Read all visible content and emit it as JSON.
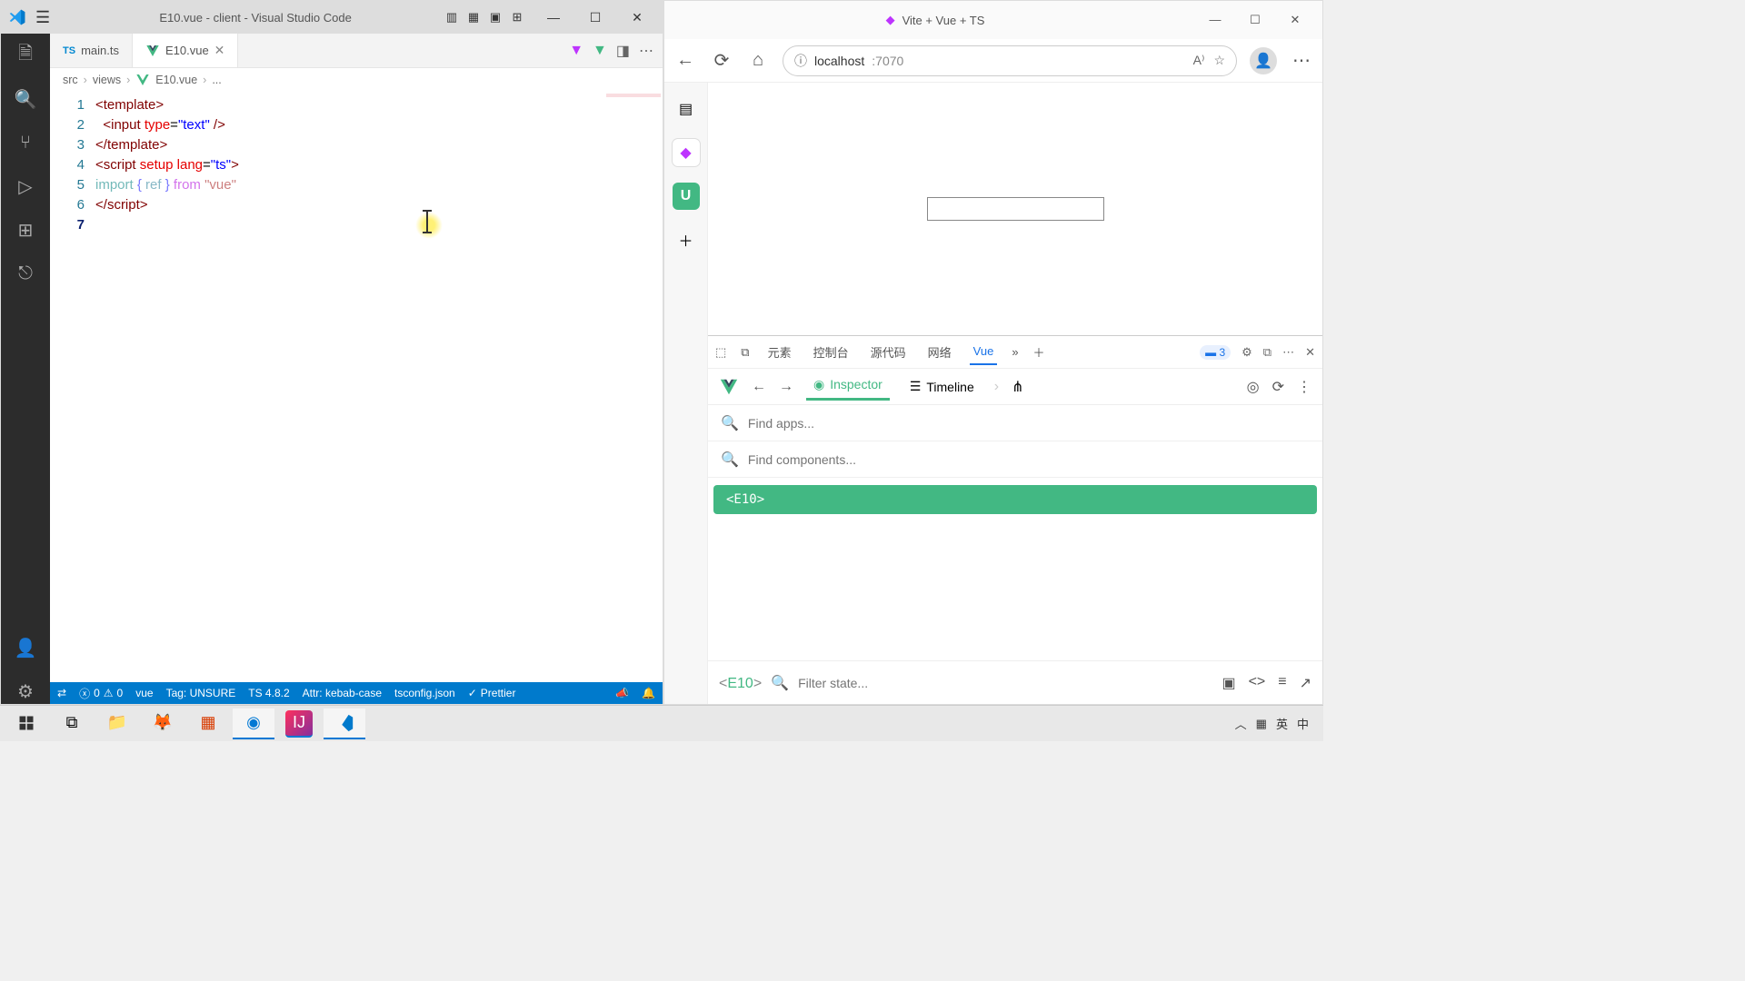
{
  "vscode": {
    "title": "E10.vue - client - Visual Studio Code",
    "tabs": [
      {
        "icon": "TS",
        "label": "main.ts",
        "active": false
      },
      {
        "icon": "V",
        "label": "E10.vue",
        "active": true
      }
    ],
    "breadcrumbs": {
      "a": "src",
      "b": "views",
      "c": "E10.vue",
      "d": "..."
    },
    "lines": [
      "1",
      "2",
      "3",
      "4",
      "5",
      "6",
      "7"
    ],
    "status": {
      "remote": "⇄",
      "errors": "0",
      "warnings": "0",
      "lang": "vue",
      "tag": "Tag: UNSURE",
      "ts": "TS 4.8.2",
      "attr": "Attr: kebab-case",
      "tsconfig": "tsconfig.json",
      "prettier": "Prettier"
    },
    "code": {
      "l1": {
        "a": "<",
        "b": "template",
        "c": ">"
      },
      "l2": {
        "indent": "  ",
        "a": "<",
        "b": "input",
        "sp": " ",
        "attr": "type",
        "eq": "=",
        "val": "\"text\"",
        "close": " />"
      },
      "l3": {
        "a": "</",
        "b": "template",
        "c": ">"
      },
      "l4": {
        "a": "<",
        "b": "script",
        "sp": " ",
        "setup": "setup",
        "sp2": " ",
        "lang": "lang",
        "eq": "=",
        "val": "\"ts\"",
        "c": ">"
      },
      "l5": {
        "imp": "import ",
        "b1": "{ ",
        "ref": "ref",
        "b2": " }",
        "from": " from ",
        "mod": "\"vue\""
      },
      "l6": {
        "a": "</",
        "b": "script",
        "c": ">"
      }
    }
  },
  "browser": {
    "title": "Vite + Vue + TS",
    "url_host": "localhost",
    "url_port": ":7070",
    "devtools": {
      "tabs": {
        "elements": "元素",
        "console": "控制台",
        "sources": "源代码",
        "network": "网络",
        "vue": "Vue"
      },
      "badge": "3",
      "inspector": "Inspector",
      "timeline": "Timeline",
      "findApps": "Find apps...",
      "findComponents": "Find components...",
      "node": "<E10>",
      "stateComp": {
        "open": "<",
        "name": "E10",
        "close": ">"
      },
      "filterState": "Filter state..."
    }
  },
  "taskbar": {
    "ime1": "英",
    "ime2": "中"
  }
}
